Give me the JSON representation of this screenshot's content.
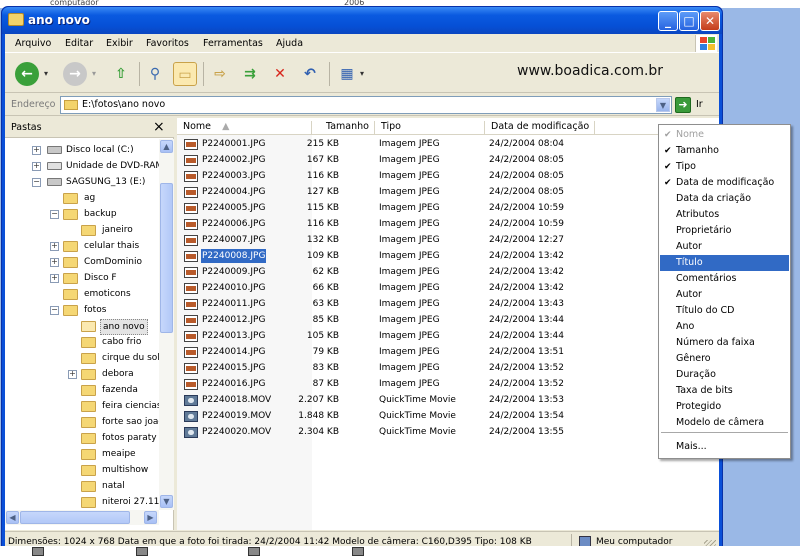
{
  "window": {
    "title": "ano novo"
  },
  "menu": [
    "Arquivo",
    "Editar",
    "Exibir",
    "Favoritos",
    "Ferramentas",
    "Ajuda"
  ],
  "toolbar": {
    "brand_text": "www.boadica.com.br"
  },
  "address": {
    "label": "Endereço",
    "path": "E:\\fotos\\ano novo",
    "go_label": "Ir"
  },
  "folders_pane": {
    "title": "Pastas",
    "items": [
      {
        "label": "Disco local (C:)",
        "expand": "+"
      },
      {
        "label": "Unidade de DVD-RAM (D:)",
        "expand": "+"
      },
      {
        "label": "SAGSUNG_13 (E:)",
        "expand": "−"
      },
      {
        "label": "ag",
        "expand": ""
      },
      {
        "label": "backup",
        "expand": "−"
      },
      {
        "label": "janeiro",
        "expand": ""
      },
      {
        "label": "celular thais",
        "expand": "+"
      },
      {
        "label": "ComDominio",
        "expand": "+"
      },
      {
        "label": "Disco F",
        "expand": "+"
      },
      {
        "label": "emoticons",
        "expand": ""
      },
      {
        "label": "fotos",
        "expand": "−"
      },
      {
        "label": "ano novo",
        "expand": ""
      },
      {
        "label": "cabo frio",
        "expand": ""
      },
      {
        "label": "cirque du soleil",
        "expand": ""
      },
      {
        "label": "debora",
        "expand": "+"
      },
      {
        "label": "fazenda",
        "expand": ""
      },
      {
        "label": "feira ciencias",
        "expand": ""
      },
      {
        "label": "forte sao joao",
        "expand": ""
      },
      {
        "label": "fotos paraty",
        "expand": ""
      },
      {
        "label": "meaipe",
        "expand": ""
      },
      {
        "label": "multishow",
        "expand": ""
      },
      {
        "label": "natal",
        "expand": ""
      },
      {
        "label": "niteroi 27.11",
        "expand": ""
      }
    ]
  },
  "columns": {
    "name": "Nome",
    "size": "Tamanho",
    "type": "Tipo",
    "date": "Data de modificação"
  },
  "files": [
    {
      "name": "P2240001.JPG",
      "size": "215 KB",
      "type": "Imagem JPEG",
      "date": "24/2/2004 08:04",
      "kind": "jpg"
    },
    {
      "name": "P2240002.JPG",
      "size": "167 KB",
      "type": "Imagem JPEG",
      "date": "24/2/2004 08:05",
      "kind": "jpg"
    },
    {
      "name": "P2240003.JPG",
      "size": "116 KB",
      "type": "Imagem JPEG",
      "date": "24/2/2004 08:05",
      "kind": "jpg"
    },
    {
      "name": "P2240004.JPG",
      "size": "127 KB",
      "type": "Imagem JPEG",
      "date": "24/2/2004 08:05",
      "kind": "jpg"
    },
    {
      "name": "P2240005.JPG",
      "size": "115 KB",
      "type": "Imagem JPEG",
      "date": "24/2/2004 10:59",
      "kind": "jpg"
    },
    {
      "name": "P2240006.JPG",
      "size": "116 KB",
      "type": "Imagem JPEG",
      "date": "24/2/2004 10:59",
      "kind": "jpg"
    },
    {
      "name": "P2240007.JPG",
      "size": "132 KB",
      "type": "Imagem JPEG",
      "date": "24/2/2004 12:27",
      "kind": "jpg"
    },
    {
      "name": "P2240008.JPG",
      "size": "109 KB",
      "type": "Imagem JPEG",
      "date": "24/2/2004 13:42",
      "kind": "jpg"
    },
    {
      "name": "P2240009.JPG",
      "size": "62 KB",
      "type": "Imagem JPEG",
      "date": "24/2/2004 13:42",
      "kind": "jpg"
    },
    {
      "name": "P2240010.JPG",
      "size": "66 KB",
      "type": "Imagem JPEG",
      "date": "24/2/2004 13:42",
      "kind": "jpg"
    },
    {
      "name": "P2240011.JPG",
      "size": "63 KB",
      "type": "Imagem JPEG",
      "date": "24/2/2004 13:43",
      "kind": "jpg"
    },
    {
      "name": "P2240012.JPG",
      "size": "85 KB",
      "type": "Imagem JPEG",
      "date": "24/2/2004 13:44",
      "kind": "jpg"
    },
    {
      "name": "P2240013.JPG",
      "size": "105 KB",
      "type": "Imagem JPEG",
      "date": "24/2/2004 13:44",
      "kind": "jpg"
    },
    {
      "name": "P2240014.JPG",
      "size": "79 KB",
      "type": "Imagem JPEG",
      "date": "24/2/2004 13:51",
      "kind": "jpg"
    },
    {
      "name": "P2240015.JPG",
      "size": "83 KB",
      "type": "Imagem JPEG",
      "date": "24/2/2004 13:52",
      "kind": "jpg"
    },
    {
      "name": "P2240016.JPG",
      "size": "87 KB",
      "type": "Imagem JPEG",
      "date": "24/2/2004 13:52",
      "kind": "jpg"
    },
    {
      "name": "P2240018.MOV",
      "size": "2.207 KB",
      "type": "QuickTime Movie",
      "date": "24/2/2004 13:53",
      "kind": "mov"
    },
    {
      "name": "P2240019.MOV",
      "size": "1.848 KB",
      "type": "QuickTime Movie",
      "date": "24/2/2004 13:54",
      "kind": "mov"
    },
    {
      "name": "P2240020.MOV",
      "size": "2.304 KB",
      "type": "QuickTime Movie",
      "date": "24/2/2004 13:55",
      "kind": "mov"
    }
  ],
  "context_menu": {
    "items": [
      {
        "label": "Nome",
        "checked": true,
        "disabled": true
      },
      {
        "label": "Tamanho",
        "checked": true
      },
      {
        "label": "Tipo",
        "checked": true
      },
      {
        "label": "Data de modificação",
        "checked": true
      },
      {
        "label": "Data da criação"
      },
      {
        "label": "Atributos"
      },
      {
        "label": "Proprietário"
      },
      {
        "label": "Autor"
      },
      {
        "label": "Título",
        "highlighted": true
      },
      {
        "label": "Comentários"
      },
      {
        "label": "Autor"
      },
      {
        "label": "Título do CD"
      },
      {
        "label": "Ano"
      },
      {
        "label": "Número da faixa"
      },
      {
        "label": "Gênero"
      },
      {
        "label": "Duração"
      },
      {
        "label": "Taxa de bits"
      },
      {
        "label": "Protegido"
      },
      {
        "label": "Modelo de câmera"
      }
    ],
    "more_label": "Mais..."
  },
  "status": {
    "details": "Dimensões: 1024 x 768 Data em que a foto foi tirada: 24/2/2004 11:42 Modelo de câmera: C160,D395 Tipo:  108 KB",
    "location": "Meu computador"
  },
  "background_text": {
    "left": "computador",
    "right": "2006"
  },
  "colors": {
    "titlebar": "#0a5ae0",
    "selection": "#316ac5",
    "chrome": "#ece9d8"
  }
}
